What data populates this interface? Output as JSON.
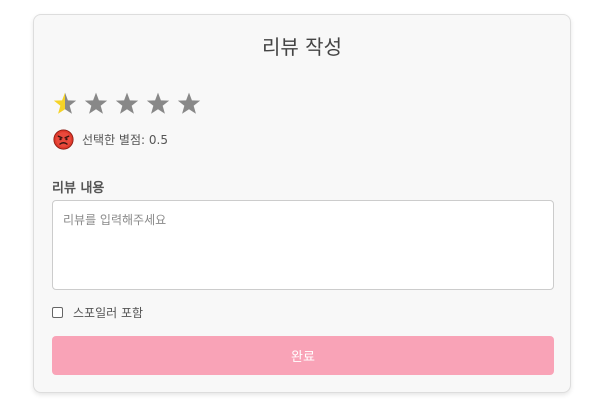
{
  "review_form": {
    "title": "리뷰 작성",
    "rating": {
      "value": 0.5,
      "max": 5,
      "text": "선택한 별점: 0.5",
      "mood_icon": "angry-face-icon"
    },
    "content": {
      "label": "리뷰 내용",
      "placeholder": "리뷰를 입력해주세요",
      "value": ""
    },
    "spoiler": {
      "label": "스포일러 포함",
      "checked": false
    },
    "submit_label": "완료"
  },
  "colors": {
    "star_filled": "#f5d327",
    "star_empty": "#888888",
    "submit_button": "#f9a3b7",
    "card_background": "#f8f8f8"
  }
}
